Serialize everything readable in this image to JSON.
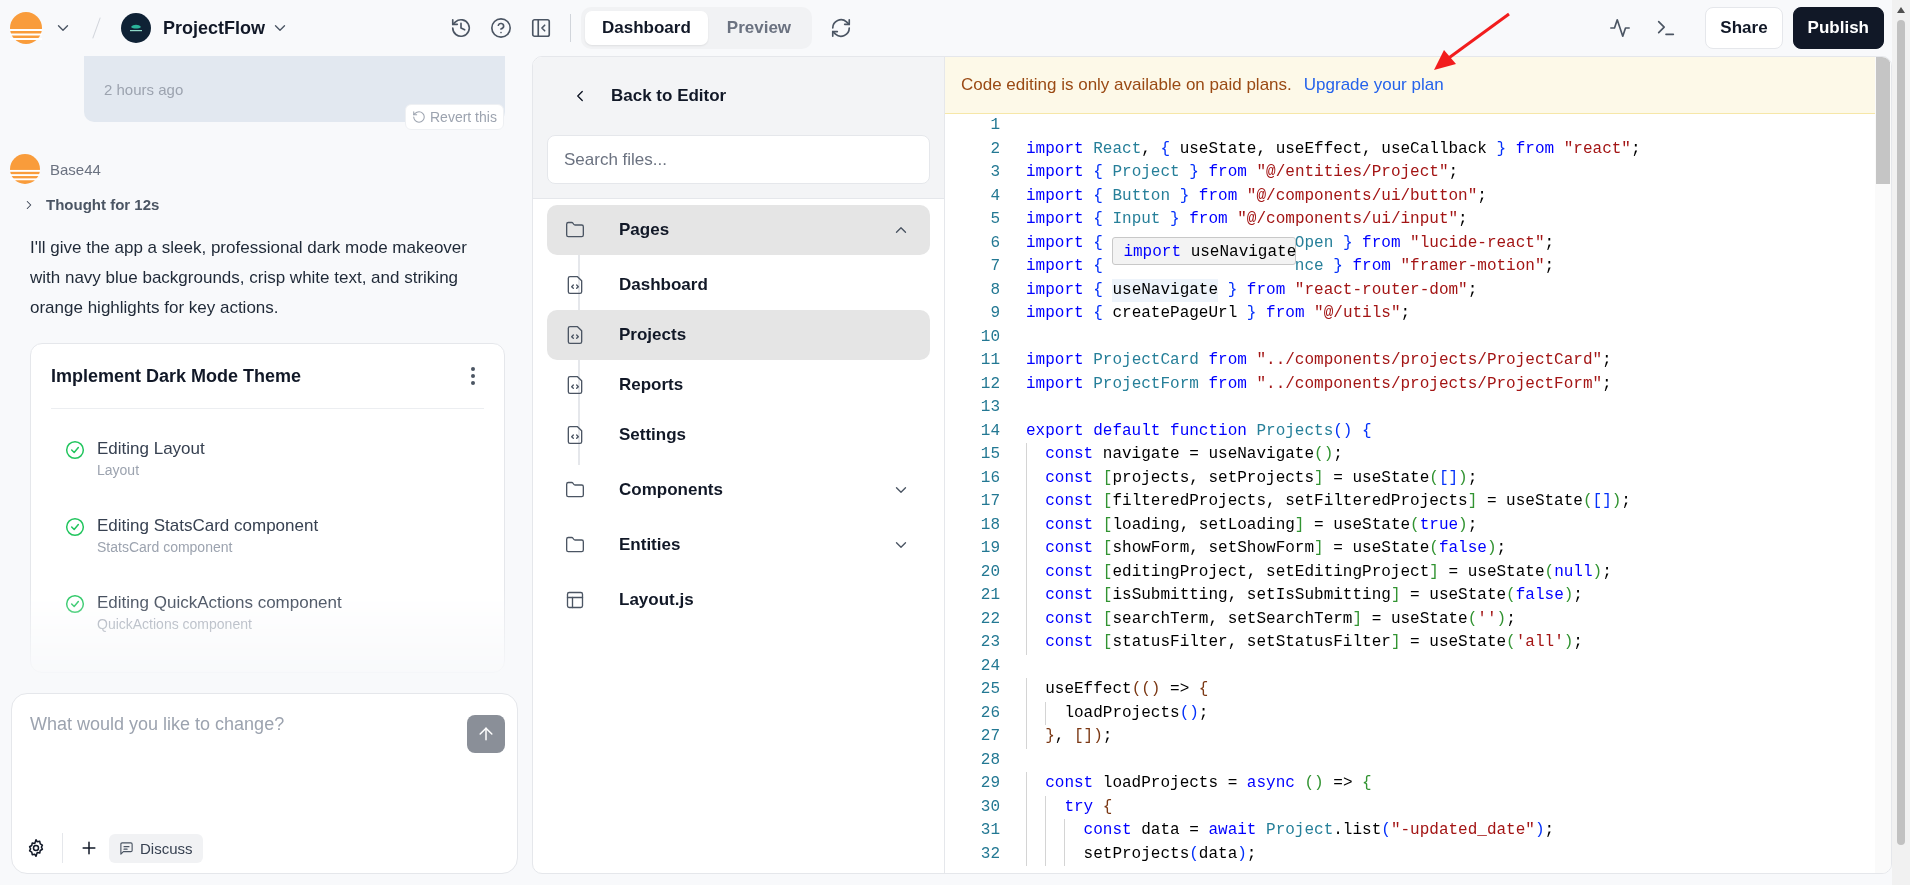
{
  "topbar": {
    "project_name": "ProjectFlow",
    "tabs": [
      {
        "label": "Dashboard",
        "selected": true
      },
      {
        "label": "Preview",
        "selected": false
      }
    ],
    "buttons": [
      {
        "label": "Share",
        "kind": "secondary"
      },
      {
        "label": "Publish",
        "kind": "primary"
      }
    ]
  },
  "chat": {
    "bubble_time": "2 hours ago",
    "revert_label": "Revert this",
    "assistant_name": "Base44",
    "thought": {
      "label": "Thought for 12s",
      "expanded": false
    },
    "message": "I'll give the app a sleek, professional dark mode makeover with navy blue backgrounds, crisp white text, and striking orange highlights for key actions.",
    "task_card": {
      "title": "Implement Dark Mode Theme",
      "tasks": [
        {
          "title": "Editing Layout",
          "subtitle": "Layout",
          "done": true
        },
        {
          "title": "Editing StatsCard component",
          "subtitle": "StatsCard component",
          "done": true
        },
        {
          "title": "Editing QuickActions component",
          "subtitle": "QuickActions component",
          "done": true
        }
      ]
    },
    "composer": {
      "placeholder": "What would you like to change?",
      "discuss_label": "Discuss"
    }
  },
  "files": {
    "back_label": "Back to Editor",
    "search_placeholder": "Search files...",
    "tree": [
      {
        "label": "Pages",
        "kind": "folder",
        "expanded": true,
        "selected": true,
        "children": [
          {
            "label": "Dashboard",
            "kind": "file",
            "selected": false
          },
          {
            "label": "Projects",
            "kind": "file",
            "selected": true
          },
          {
            "label": "Reports",
            "kind": "file",
            "selected": false
          },
          {
            "label": "Settings",
            "kind": "file",
            "selected": false
          }
        ]
      },
      {
        "label": "Components",
        "kind": "folder",
        "expanded": false,
        "selected": false
      },
      {
        "label": "Entities",
        "kind": "folder",
        "expanded": false,
        "selected": false
      },
      {
        "label": "Layout.js",
        "kind": "layout",
        "selected": false
      }
    ]
  },
  "editor": {
    "notice": "Code editing is only available on paid plans.",
    "notice_link": "Upgrade your plan",
    "tooltip": [
      {
        "kind": "keyword",
        "text": "import "
      },
      {
        "kind": "plain",
        "text": "useNavigate"
      }
    ],
    "lines": [
      {
        "number": "1"
      },
      {
        "number": "2",
        "tokens": [
          {
            "kind": "keyword",
            "text": "import "
          },
          {
            "kind": "type",
            "text": "React"
          },
          {
            "kind": "plain",
            "text": ", "
          },
          {
            "kind": "bracket1",
            "text": "{"
          },
          {
            "kind": "plain",
            "text": " useState, useEffect, useCallback "
          },
          {
            "kind": "bracket1",
            "text": "}"
          },
          {
            "kind": "keyword",
            "text": " from "
          },
          {
            "kind": "string",
            "text": "\"react\""
          },
          {
            "kind": "plain",
            "text": ";"
          }
        ]
      },
      {
        "number": "3",
        "tokens": [
          {
            "kind": "keyword",
            "text": "import "
          },
          {
            "kind": "bracket1",
            "text": "{"
          },
          {
            "kind": "type",
            "text": " Project "
          },
          {
            "kind": "bracket1",
            "text": "}"
          },
          {
            "kind": "keyword",
            "text": " from "
          },
          {
            "kind": "string",
            "text": "\"@/entities/Project\""
          },
          {
            "kind": "plain",
            "text": ";"
          }
        ]
      },
      {
        "number": "4",
        "tokens": [
          {
            "kind": "keyword",
            "text": "import "
          },
          {
            "kind": "bracket1",
            "text": "{"
          },
          {
            "kind": "type",
            "text": " Button "
          },
          {
            "kind": "bracket1",
            "text": "}"
          },
          {
            "kind": "keyword",
            "text": " from "
          },
          {
            "kind": "string",
            "text": "\"@/components/ui/button\""
          },
          {
            "kind": "plain",
            "text": ";"
          }
        ]
      },
      {
        "number": "5",
        "tokens": [
          {
            "kind": "keyword",
            "text": "import "
          },
          {
            "kind": "bracket1",
            "text": "{"
          },
          {
            "kind": "type",
            "text": " Input "
          },
          {
            "kind": "bracket1",
            "text": "}"
          },
          {
            "kind": "keyword",
            "text": " from "
          },
          {
            "kind": "string",
            "text": "\"@/components/ui/input\""
          },
          {
            "kind": "plain",
            "text": ";"
          }
        ]
      },
      {
        "number": "6",
        "tokens": [
          {
            "kind": "keyword",
            "text": "import "
          },
          {
            "kind": "bracket1",
            "text": "{"
          },
          {
            "kind": "gap"
          },
          {
            "kind": "type",
            "text": "Open "
          },
          {
            "kind": "bracket1",
            "text": "}"
          },
          {
            "kind": "keyword",
            "text": " from "
          },
          {
            "kind": "string",
            "text": "\"lucide-react\""
          },
          {
            "kind": "plain",
            "text": ";"
          }
        ]
      },
      {
        "number": "7",
        "tokens": [
          {
            "kind": "keyword",
            "text": "import "
          },
          {
            "kind": "bracket1",
            "text": "{"
          },
          {
            "kind": "gap"
          },
          {
            "kind": "type",
            "text": "nce "
          },
          {
            "kind": "bracket1",
            "text": "}"
          },
          {
            "kind": "keyword",
            "text": " from "
          },
          {
            "kind": "string",
            "text": "\"framer-motion\""
          },
          {
            "kind": "plain",
            "text": ";"
          }
        ]
      },
      {
        "number": "8",
        "tokens": [
          {
            "kind": "keyword",
            "text": "import "
          },
          {
            "kind": "bracket1",
            "text": "{ "
          },
          {
            "kind": "match",
            "text": "useNavigate"
          },
          {
            "kind": "bracket1",
            "text": " }"
          },
          {
            "kind": "keyword",
            "text": " from "
          },
          {
            "kind": "string",
            "text": "\"react-router-dom\""
          },
          {
            "kind": "plain",
            "text": ";"
          }
        ]
      },
      {
        "number": "9",
        "tokens": [
          {
            "kind": "keyword",
            "text": "import "
          },
          {
            "kind": "bracket1",
            "text": "{"
          },
          {
            "kind": "plain",
            "text": " createPageUrl "
          },
          {
            "kind": "bracket1",
            "text": "}"
          },
          {
            "kind": "keyword",
            "text": " from "
          },
          {
            "kind": "string",
            "text": "\"@/utils\""
          },
          {
            "kind": "plain",
            "text": ";"
          }
        ]
      },
      {
        "number": "10"
      },
      {
        "number": "11",
        "tokens": [
          {
            "kind": "keyword",
            "text": "import "
          },
          {
            "kind": "type",
            "text": "ProjectCard"
          },
          {
            "kind": "keyword",
            "text": " from "
          },
          {
            "kind": "string",
            "text": "\"../components/projects/ProjectCard\""
          },
          {
            "kind": "plain",
            "text": ";"
          }
        ]
      },
      {
        "number": "12",
        "tokens": [
          {
            "kind": "keyword",
            "text": "import "
          },
          {
            "kind": "type",
            "text": "ProjectForm"
          },
          {
            "kind": "keyword",
            "text": " from "
          },
          {
            "kind": "string",
            "text": "\"../components/projects/ProjectForm\""
          },
          {
            "kind": "plain",
            "text": ";"
          }
        ]
      },
      {
        "number": "13"
      },
      {
        "number": "14",
        "tokens": [
          {
            "kind": "keyword",
            "text": "export default function "
          },
          {
            "kind": "type",
            "text": "Projects"
          },
          {
            "kind": "bracket1",
            "text": "() {"
          }
        ]
      },
      {
        "number": "15",
        "tokens": [
          {
            "kind": "keyword",
            "text": "  const "
          },
          {
            "kind": "plain",
            "text": "navigate = useNavigate"
          },
          {
            "kind": "bracket2",
            "text": "()"
          },
          {
            "kind": "plain",
            "text": ";"
          }
        ]
      },
      {
        "number": "16",
        "tokens": [
          {
            "kind": "keyword",
            "text": "  const "
          },
          {
            "kind": "bracket2",
            "text": "["
          },
          {
            "kind": "plain",
            "text": "projects, setProjects"
          },
          {
            "kind": "bracket2",
            "text": "]"
          },
          {
            "kind": "plain",
            "text": " = useState"
          },
          {
            "kind": "bracket2",
            "text": "("
          },
          {
            "kind": "bracket1",
            "text": "[]"
          },
          {
            "kind": "bracket2",
            "text": ")"
          },
          {
            "kind": "plain",
            "text": ";"
          }
        ]
      },
      {
        "number": "17",
        "tokens": [
          {
            "kind": "keyword",
            "text": "  const "
          },
          {
            "kind": "bracket2",
            "text": "["
          },
          {
            "kind": "plain",
            "text": "filteredProjects, setFilteredProjects"
          },
          {
            "kind": "bracket2",
            "text": "]"
          },
          {
            "kind": "plain",
            "text": " = useState"
          },
          {
            "kind": "bracket2",
            "text": "("
          },
          {
            "kind": "bracket1",
            "text": "[]"
          },
          {
            "kind": "bracket2",
            "text": ")"
          },
          {
            "kind": "plain",
            "text": ";"
          }
        ]
      },
      {
        "number": "18",
        "tokens": [
          {
            "kind": "keyword",
            "text": "  const "
          },
          {
            "kind": "bracket2",
            "text": "["
          },
          {
            "kind": "plain",
            "text": "loading, setLoading"
          },
          {
            "kind": "bracket2",
            "text": "]"
          },
          {
            "kind": "plain",
            "text": " = useState"
          },
          {
            "kind": "bracket2",
            "text": "("
          },
          {
            "kind": "keyword",
            "text": "true"
          },
          {
            "kind": "bracket2",
            "text": ")"
          },
          {
            "kind": "plain",
            "text": ";"
          }
        ]
      },
      {
        "number": "19",
        "tokens": [
          {
            "kind": "keyword",
            "text": "  const "
          },
          {
            "kind": "bracket2",
            "text": "["
          },
          {
            "kind": "plain",
            "text": "showForm, setShowForm"
          },
          {
            "kind": "bracket2",
            "text": "]"
          },
          {
            "kind": "plain",
            "text": " = useState"
          },
          {
            "kind": "bracket2",
            "text": "("
          },
          {
            "kind": "keyword",
            "text": "false"
          },
          {
            "kind": "bracket2",
            "text": ")"
          },
          {
            "kind": "plain",
            "text": ";"
          }
        ]
      },
      {
        "number": "20",
        "tokens": [
          {
            "kind": "keyword",
            "text": "  const "
          },
          {
            "kind": "bracket2",
            "text": "["
          },
          {
            "kind": "plain",
            "text": "editingProject, setEditingProject"
          },
          {
            "kind": "bracket2",
            "text": "]"
          },
          {
            "kind": "plain",
            "text": " = useState"
          },
          {
            "kind": "bracket2",
            "text": "("
          },
          {
            "kind": "keyword",
            "text": "null"
          },
          {
            "kind": "bracket2",
            "text": ")"
          },
          {
            "kind": "plain",
            "text": ";"
          }
        ]
      },
      {
        "number": "21",
        "tokens": [
          {
            "kind": "keyword",
            "text": "  const "
          },
          {
            "kind": "bracket2",
            "text": "["
          },
          {
            "kind": "plain",
            "text": "isSubmitting, setIsSubmitting"
          },
          {
            "kind": "bracket2",
            "text": "]"
          },
          {
            "kind": "plain",
            "text": " = useState"
          },
          {
            "kind": "bracket2",
            "text": "("
          },
          {
            "kind": "keyword",
            "text": "false"
          },
          {
            "kind": "bracket2",
            "text": ")"
          },
          {
            "kind": "plain",
            "text": ";"
          }
        ]
      },
      {
        "number": "22",
        "tokens": [
          {
            "kind": "keyword",
            "text": "  const "
          },
          {
            "kind": "bracket2",
            "text": "["
          },
          {
            "kind": "plain",
            "text": "searchTerm, setSearchTerm"
          },
          {
            "kind": "bracket2",
            "text": "]"
          },
          {
            "kind": "plain",
            "text": " = useState"
          },
          {
            "kind": "bracket2",
            "text": "("
          },
          {
            "kind": "string",
            "text": "''"
          },
          {
            "kind": "bracket2",
            "text": ")"
          },
          {
            "kind": "plain",
            "text": ";"
          }
        ]
      },
      {
        "number": "23",
        "tokens": [
          {
            "kind": "keyword",
            "text": "  const "
          },
          {
            "kind": "bracket2",
            "text": "["
          },
          {
            "kind": "plain",
            "text": "statusFilter, setStatusFilter"
          },
          {
            "kind": "bracket2",
            "text": "]"
          },
          {
            "kind": "plain",
            "text": " = useState"
          },
          {
            "kind": "bracket2",
            "text": "("
          },
          {
            "kind": "string",
            "text": "'all'"
          },
          {
            "kind": "bracket2",
            "text": ")"
          },
          {
            "kind": "plain",
            "text": ";"
          }
        ]
      },
      {
        "number": "24"
      },
      {
        "number": "25",
        "tokens": [
          {
            "kind": "plain",
            "text": "  useEffect"
          },
          {
            "kind": "bracket3",
            "text": "(()"
          },
          {
            "kind": "plain",
            "text": " => "
          },
          {
            "kind": "bracket3",
            "text": "{"
          }
        ]
      },
      {
        "number": "26",
        "tokens": [
          {
            "kind": "plain",
            "text": "    loadProjects"
          },
          {
            "kind": "bracket1",
            "text": "()"
          },
          {
            "kind": "plain",
            "text": ";"
          }
        ]
      },
      {
        "number": "27",
        "tokens": [
          {
            "kind": "bracket3",
            "text": "  }"
          },
          {
            "kind": "plain",
            "text": ", "
          },
          {
            "kind": "bracket3",
            "text": "[])"
          },
          {
            "kind": "plain",
            "text": ";"
          }
        ]
      },
      {
        "number": "28"
      },
      {
        "number": "29",
        "tokens": [
          {
            "kind": "keyword",
            "text": "  const "
          },
          {
            "kind": "plain",
            "text": "loadProjects = "
          },
          {
            "kind": "keyword",
            "text": "async"
          },
          {
            "kind": "bracket2",
            "text": " ()"
          },
          {
            "kind": "plain",
            "text": " => "
          },
          {
            "kind": "bracket2",
            "text": "{"
          }
        ]
      },
      {
        "number": "30",
        "tokens": [
          {
            "kind": "keyword",
            "text": "    try "
          },
          {
            "kind": "bracket3",
            "text": "{"
          }
        ]
      },
      {
        "number": "31",
        "tokens": [
          {
            "kind": "keyword",
            "text": "      const "
          },
          {
            "kind": "plain",
            "text": "data = "
          },
          {
            "kind": "keyword",
            "text": "await "
          },
          {
            "kind": "type",
            "text": "Project"
          },
          {
            "kind": "plain",
            "text": ".list"
          },
          {
            "kind": "bracket1",
            "text": "("
          },
          {
            "kind": "string",
            "text": "\"-updated_date\""
          },
          {
            "kind": "bracket1",
            "text": ")"
          },
          {
            "kind": "plain",
            "text": ";"
          }
        ]
      },
      {
        "number": "32",
        "tokens": [
          {
            "kind": "plain",
            "text": "      setProjects"
          },
          {
            "kind": "bracket1",
            "text": "("
          },
          {
            "kind": "plain",
            "text": "data"
          },
          {
            "kind": "bracket1",
            "text": ")"
          },
          {
            "kind": "plain",
            "text": ";"
          }
        ]
      }
    ]
  }
}
